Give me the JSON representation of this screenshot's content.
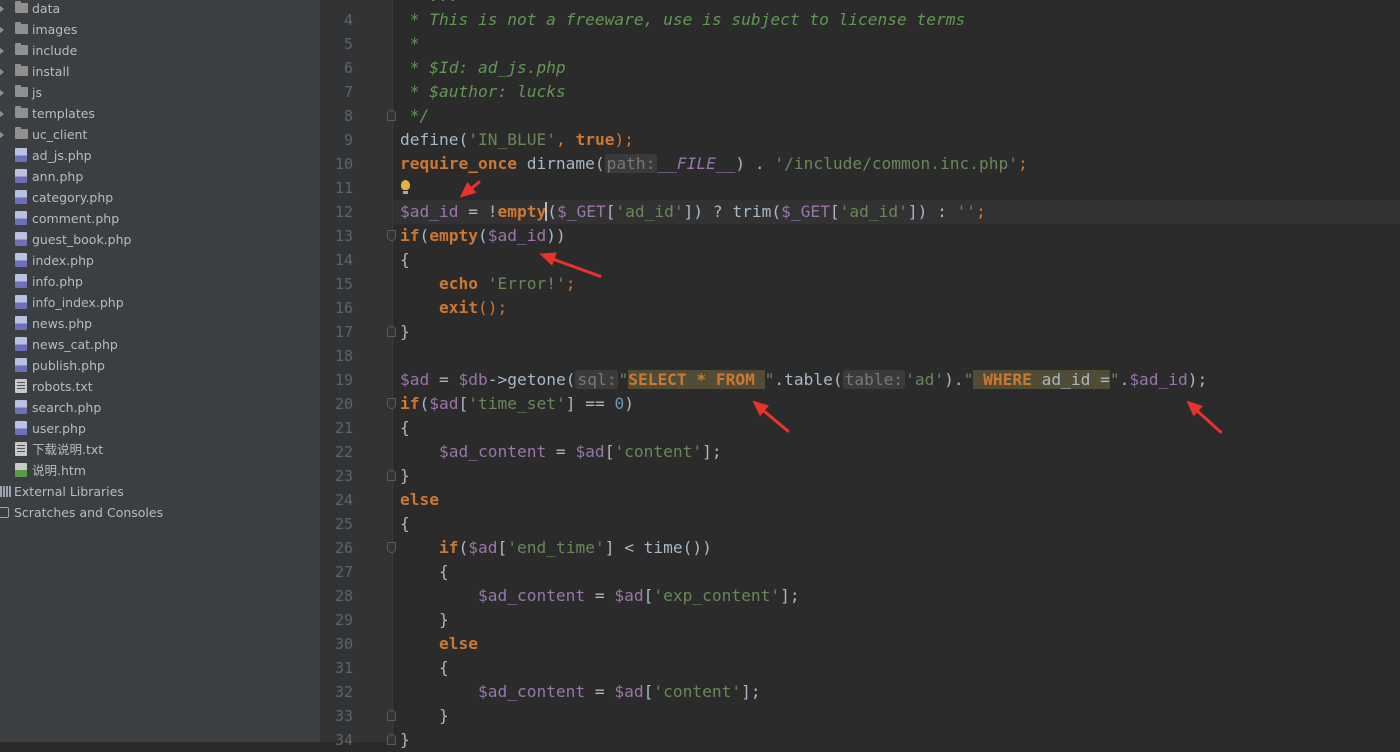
{
  "project_tree": {
    "folders": [
      {
        "name": "data"
      },
      {
        "name": "images"
      },
      {
        "name": "include"
      },
      {
        "name": "install"
      },
      {
        "name": "js"
      },
      {
        "name": "templates"
      },
      {
        "name": "uc_client"
      }
    ],
    "files": [
      {
        "name": "ad_js.php",
        "icon": "php-file-icon"
      },
      {
        "name": "ann.php",
        "icon": "php-file-icon"
      },
      {
        "name": "category.php",
        "icon": "php-file-icon"
      },
      {
        "name": "comment.php",
        "icon": "php-file-icon"
      },
      {
        "name": "guest_book.php",
        "icon": "php-file-icon"
      },
      {
        "name": "index.php",
        "icon": "php-file-icon"
      },
      {
        "name": "info.php",
        "icon": "php-file-icon"
      },
      {
        "name": "info_index.php",
        "icon": "php-file-icon"
      },
      {
        "name": "news.php",
        "icon": "php-file-icon"
      },
      {
        "name": "news_cat.php",
        "icon": "php-file-icon"
      },
      {
        "name": "publish.php",
        "icon": "php-file-icon"
      },
      {
        "name": "robots.txt",
        "icon": "text-file-icon"
      },
      {
        "name": "search.php",
        "icon": "php-file-icon"
      },
      {
        "name": "user.php",
        "icon": "php-file-icon"
      },
      {
        "name": "下载说明.txt",
        "icon": "text-file-icon"
      },
      {
        "name": "说明.htm",
        "icon": "html-file-icon"
      }
    ],
    "external_libraries": "External Libraries",
    "scratches": "Scratches and Consoles"
  },
  "editor": {
    "line_numbers": [
      "4",
      "5",
      "6",
      "7",
      "8",
      "9",
      "10",
      "11",
      "12",
      "13",
      "14",
      "15",
      "16",
      "17",
      "18",
      "19",
      "20",
      "21",
      "22",
      "23",
      "24",
      "25",
      "26",
      "27",
      "28",
      "29",
      "30",
      "31",
      "32",
      "33",
      "34"
    ],
    "line4": " * This is not a freeware, use is subject to license terms",
    "line5": " *",
    "line6": " * $Id: ad_js.php",
    "line7": " * $author: lucks",
    "line8": " */",
    "line9": {
      "a": "define(",
      "b": "'IN_BLUE'",
      "c": ", ",
      "d": "true",
      "e": ");"
    },
    "line10": {
      "a": "require_once",
      "b": " dirname(",
      "hint": "path:",
      "c": "__FILE__",
      "d": ") . ",
      "e": "'/include/common.inc.php'",
      "f": ";"
    },
    "line12": {
      "a": "$ad_id",
      "b": " = !",
      "c": "empty",
      "d": "(",
      "e": "$_GET",
      "f": "[",
      "g": "'ad_id'",
      "h": "]) ? trim(",
      "i": "$_GET",
      "j": "[",
      "k": "'ad_id'",
      "l": "]) : ",
      "m": "''",
      "n": ";"
    },
    "line13": {
      "a": "if",
      "b": "(",
      "c": "empty",
      "d": "(",
      "e": "$ad_id",
      "f": "))"
    },
    "line14": "{",
    "line15": {
      "a": "echo",
      "b": " ",
      "c": "'Error!'",
      "d": ";"
    },
    "line16": {
      "a": "exit",
      "b": "();"
    },
    "line17": "}",
    "line19": {
      "a": "$ad",
      "b": " = ",
      "c": "$db",
      "d": "->getone(",
      "hint1": "sql:",
      "e": "\"",
      "f": "SELECT * FROM ",
      "g": "\"",
      "h": ".table(",
      "hint2": "table:",
      "i": "'ad'",
      "j": ").",
      "k": "\"",
      "l": " WHERE",
      "m": " ad_id =",
      "n": "\"",
      "o": ".",
      "p": "$ad_id",
      "q": ");"
    },
    "line20": {
      "a": "if",
      "b": "(",
      "c": "$ad",
      "d": "[",
      "e": "'time_set'",
      "f": "] == ",
      "g": "0",
      "h": ")"
    },
    "line21": "{",
    "line22": {
      "a": "$ad_content",
      "b": " = ",
      "c": "$ad",
      "d": "[",
      "e": "'content'",
      "f": "];"
    },
    "line23": "}",
    "line24": "else",
    "line25": "{",
    "line26": {
      "a": "if",
      "b": "(",
      "c": "$ad",
      "d": "[",
      "e": "'end_time'",
      "f": "] < time())"
    },
    "line27": "{",
    "line28": {
      "a": "$ad_content",
      "b": " = ",
      "c": "$ad",
      "d": "[",
      "e": "'exp_content'",
      "f": "];"
    },
    "line29": "}",
    "line30": "else",
    "line31": "{",
    "line32": {
      "a": "$ad_content",
      "b": " = ",
      "c": "$ad",
      "d": "[",
      "e": "'content'",
      "f": "];"
    },
    "line33": "}",
    "line34": "}"
  },
  "colors": {
    "keyword": "#cc7832",
    "string": "#6a8759",
    "variable": "#9876aa",
    "comment": "#629755",
    "number": "#6897bb",
    "annotation_arrow": "#e8332c"
  }
}
